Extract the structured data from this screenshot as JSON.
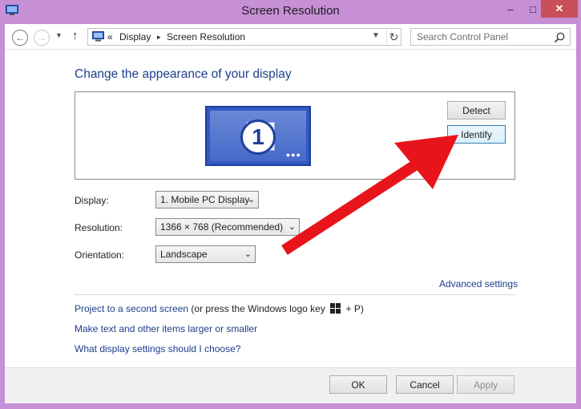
{
  "window": {
    "title": "Screen Resolution",
    "controls": {
      "minimize": "–",
      "maximize": "□",
      "close": "✕"
    }
  },
  "nav": {
    "breadcrumb": [
      "Display",
      "Screen Resolution"
    ],
    "breadcrumb_sep": "▸",
    "overflow": "«",
    "search_placeholder": "Search Control Panel"
  },
  "main": {
    "heading": "Change the appearance of your display",
    "monitor_number": "1",
    "detect_label": "Detect",
    "identify_label": "Identify",
    "fields": [
      {
        "label": "Display:",
        "value": "1. Mobile PC Display"
      },
      {
        "label": "Resolution:",
        "value": "1366 × 768 (Recommended)"
      },
      {
        "label": "Orientation:",
        "value": "Landscape"
      }
    ],
    "advanced_link": "Advanced settings",
    "project_link": "Project to a second screen",
    "project_hint_before": "(or press the Windows logo key",
    "project_hint_after": "+ P)",
    "text_size_link": "Make text and other items larger or smaller",
    "help_link": "What display settings should I choose?"
  },
  "footer": {
    "ok_label": "OK",
    "cancel_label": "Cancel",
    "apply_label": "Apply"
  },
  "colors": {
    "frame": "#c68fd6",
    "link": "#1e3e8c",
    "annotation_arrow": "#e8141c",
    "monitor_blue": "#3159c2"
  }
}
